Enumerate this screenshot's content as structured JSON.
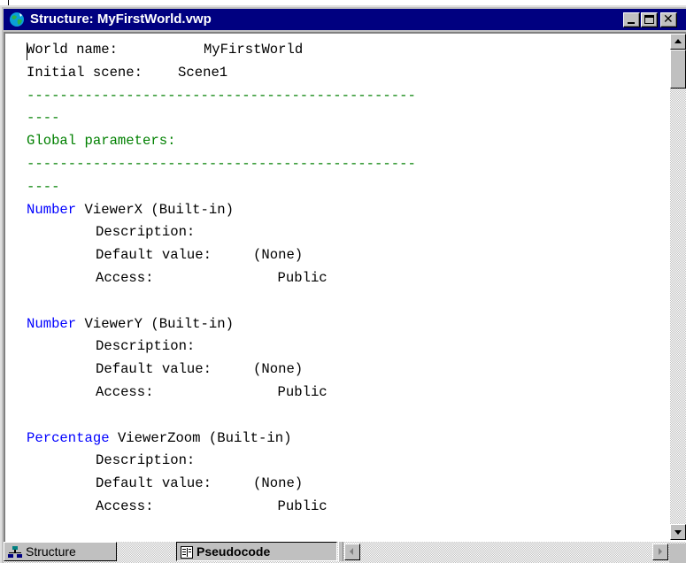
{
  "window": {
    "title": "Structure: MyFirstWorld.vwp",
    "app_icon": "globe-icon"
  },
  "document": {
    "world_name_label": "World name:",
    "world_name_value": "MyFirstWorld",
    "initial_scene_label": "Initial scene:",
    "initial_scene_value": "Scene1",
    "separator_long": "-----------------------------------------------",
    "separator_short": "----",
    "global_params_heading": "Global parameters:",
    "parameters": [
      {
        "type": "Number",
        "name": "ViewerX (Built-in)",
        "description_label": "Description:",
        "default_label": "Default value:",
        "default_value": "(None)",
        "access_label": "Access:",
        "access_value": "Public"
      },
      {
        "type": "Number",
        "name": "ViewerY (Built-in)",
        "description_label": "Description:",
        "default_label": "Default value:",
        "default_value": "(None)",
        "access_label": "Access:",
        "access_value": "Public"
      },
      {
        "type": "Percentage",
        "name": "ViewerZoom (Built-in)",
        "description_label": "Description:",
        "default_label": "Default value:",
        "default_value": "(None)",
        "access_label": "Access:",
        "access_value": "Public"
      }
    ]
  },
  "tabs": [
    {
      "label": "Structure",
      "icon": "tree-icon",
      "active": false
    },
    {
      "label": "Pseudocode",
      "icon": "document-icon",
      "active": true
    }
  ],
  "colors": {
    "titlebar": "#000080",
    "section_text": "#008000",
    "keyword_text": "#0000ff"
  }
}
